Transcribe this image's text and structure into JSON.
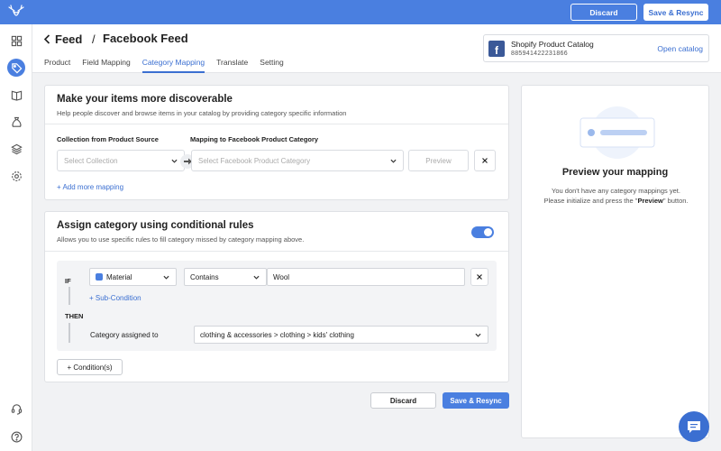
{
  "topbar": {
    "discard_label": "Discard",
    "save_label": "Save & Resync"
  },
  "sidebar": {
    "items": [
      {
        "icon": "grid-icon",
        "active": false
      },
      {
        "icon": "tag-icon",
        "active": true
      },
      {
        "icon": "book-icon",
        "active": false
      },
      {
        "icon": "moneybag-icon",
        "active": false
      },
      {
        "icon": "layers-icon",
        "active": false
      },
      {
        "icon": "settings-icon",
        "active": false
      },
      {
        "icon": "headset-icon",
        "active": false
      },
      {
        "icon": "help-icon",
        "active": false
      }
    ]
  },
  "header": {
    "back_label": "Feed",
    "separator": "/",
    "title": "Facebook Feed",
    "tabs": [
      {
        "label": "Product",
        "active": false
      },
      {
        "label": "Field Mapping",
        "active": false
      },
      {
        "label": "Category Mapping",
        "active": true
      },
      {
        "label": "Translate",
        "active": false
      },
      {
        "label": "Setting",
        "active": false
      }
    ]
  },
  "catalog": {
    "icon_letter": "f",
    "name": "Shopify Product Catalog",
    "id": "885941422231866",
    "open_label": "Open catalog"
  },
  "mapping_card": {
    "title": "Make your items more discoverable",
    "subtitle": "Help people discover and browse items in your catalog by providing category specific information",
    "collection_label": "Collection from Product Source",
    "mapping_label": "Mapping to Facebook Product Category",
    "collection_placeholder": "Select Collection",
    "category_placeholder": "Select Facebook Product Category",
    "preview_label": "Preview",
    "add_more_label": "+ Add more mapping"
  },
  "rules_card": {
    "title": "Assign category using conditional rules",
    "subtitle": "Allows you to use specific rules to fill category missed by category mapping above.",
    "toggle_on": true,
    "if_label": "IF",
    "field_value": "Material",
    "operator_value": "Contains",
    "condition_value": "Wool",
    "subcondition_label": "+ Sub-Condition",
    "then_label": "THEN",
    "assigned_label": "Category assigned to",
    "assigned_value": "clothing & accessories > clothing > kids' clothing",
    "add_condition_label": "+ Condition(s)"
  },
  "footer": {
    "discard_label": "Discard",
    "save_label": "Save & Resync"
  },
  "preview_panel": {
    "title": "Preview your mapping",
    "desc_line1": "You don't have any category mappings yet.",
    "desc_pre": "Please initialize and press the \"",
    "desc_bold": "Preview",
    "desc_post": "\" button."
  },
  "colors": {
    "accent": "#4a7fe0",
    "link": "#3b6fd1",
    "facebook": "#3b5998"
  }
}
